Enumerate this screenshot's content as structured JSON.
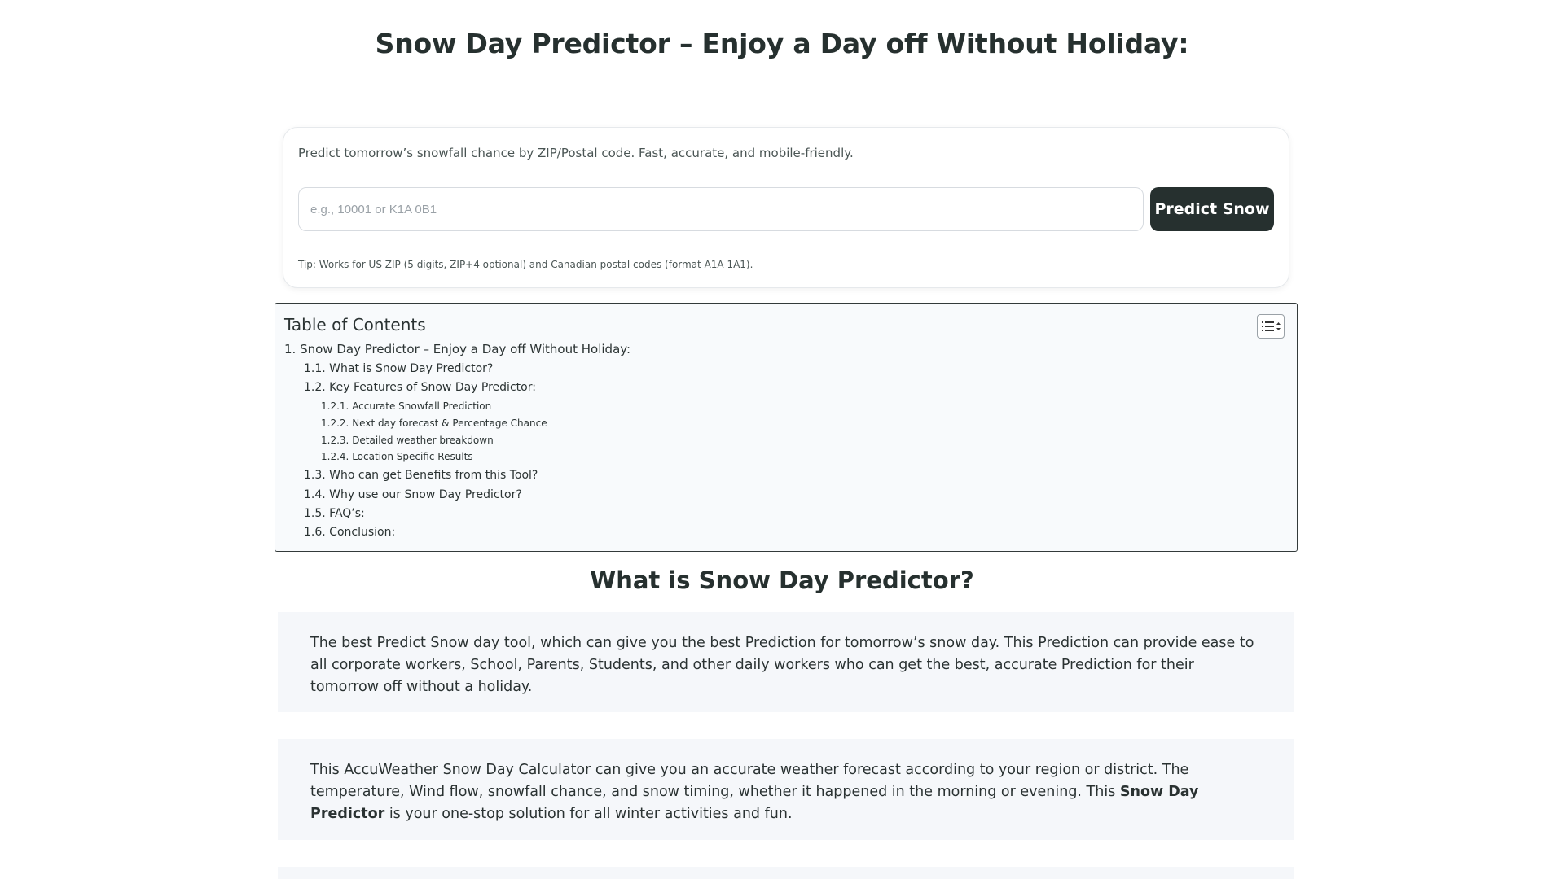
{
  "page": {
    "title": "Snow Day Predictor – Enjoy a Day off Without Holiday:"
  },
  "predictor": {
    "description": "Predict tomorrow’s snowfall chance by ZIP/Postal code. Fast, accurate, and mobile-friendly.",
    "input_placeholder": "e.g., 10001 or K1A 0B1",
    "input_value": "",
    "button_label": "Predict Snow",
    "tip": "Tip: Works for US ZIP (5 digits, ZIP+4 optional) and Canadian postal codes (format A1A 1A1)."
  },
  "toc": {
    "title": "Table of Contents",
    "toggle_icon": "list-toggle-icon",
    "items": [
      {
        "num": "1.",
        "label": "Snow Day Predictor – Enjoy a Day off Without Holiday:"
      },
      {
        "num": "1.1.",
        "label": "What is Snow Day Predictor?"
      },
      {
        "num": "1.2.",
        "label": "Key Features of Snow Day Predictor:"
      },
      {
        "num": "1.2.1.",
        "label": "Accurate Snowfall Prediction"
      },
      {
        "num": "1.2.2.",
        "label": "Next day forecast & Percentage Chance"
      },
      {
        "num": "1.2.3.",
        "label": "Detailed weather breakdown"
      },
      {
        "num": "1.2.4.",
        "label": "Location Specific Results"
      },
      {
        "num": "1.3.",
        "label": "Who can get Benefits from this Tool?"
      },
      {
        "num": "1.4.",
        "label": "Why use our Snow Day Predictor?"
      },
      {
        "num": "1.5.",
        "label": "FAQ’s:"
      },
      {
        "num": "1.6.",
        "label": "Conclusion:"
      }
    ]
  },
  "content": {
    "section_heading": "What is Snow Day Predictor?",
    "paragraph1": "The best Predict Snow day tool, which can give you the best Prediction for tomorrow’s snow day. This Prediction can provide ease to all corporate workers, School, Parents, Students, and other daily workers who can get the best, accurate Prediction for their tomorrow off without a holiday.",
    "paragraph2_before": "This AccuWeather Snow Day Calculator can give you an accurate weather forecast according to your region or district. The temperature, Wind flow, snowfall chance, and snow timing, whether it happened in the morning or evening. This ",
    "paragraph2_bold": "Snow Day Predictor",
    "paragraph2_after": " is your one-stop solution for all winter activities and fun."
  },
  "colors": {
    "button_bg": "#26302f",
    "paragraph_box_bg": "#f5f7fa",
    "toc_bg": "#f8fafc"
  }
}
